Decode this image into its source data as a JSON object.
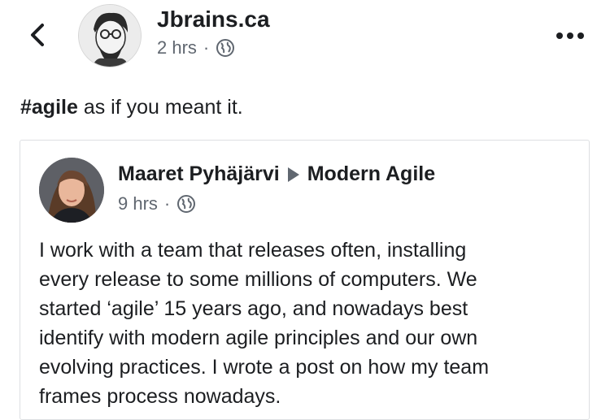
{
  "header": {
    "page_name": "Jbrains.ca",
    "time": "2 hrs",
    "separator": "·",
    "privacy_icon": "globe-icon",
    "back_icon": "chevron-left-icon",
    "more_icon": "more-horizontal-icon"
  },
  "post": {
    "hashtag": "#agile",
    "text_rest": " as if you meant it."
  },
  "shared": {
    "author": "Maaret Pyhäjärvi",
    "arrow_icon": "triangle-right-icon",
    "group": "Modern Agile",
    "time": "9 hrs",
    "separator": "·",
    "privacy_icon": "globe-icon",
    "body": "I work with a team that releases often, installing\nevery release to some millions of computers. We\nstarted ‘agile’ 15 years ago, and nowadays best\nidentify with modern agile principles and our own\nevolving practices. I wrote a post on how my team\nframes process nowadays."
  },
  "colors": {
    "text": "#1c1e21",
    "meta": "#606770",
    "border": "#dddfe2"
  }
}
